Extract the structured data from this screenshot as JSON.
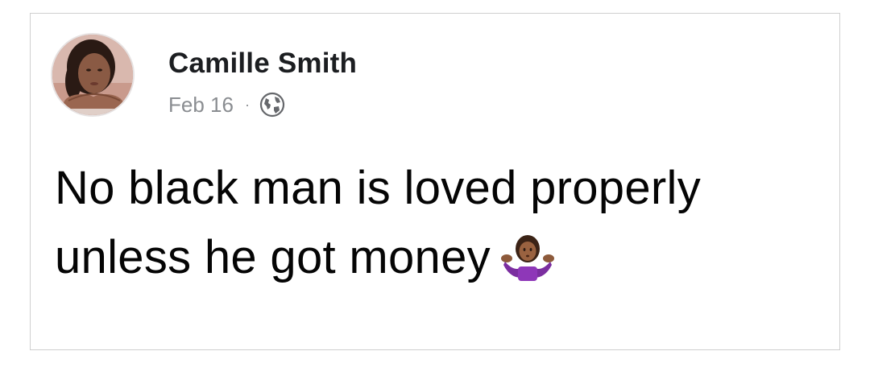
{
  "post": {
    "author_name": "Camille Smith",
    "date": "Feb 16",
    "separator": "·",
    "privacy_icon": "globe-icon",
    "text_line_1": "No black man is loved properly",
    "text_line_2": "unless he got money",
    "emoji": "person-shrugging-emoji"
  },
  "colors": {
    "name_text": "#1c1e21",
    "meta_text": "#8a8d91",
    "body_text": "#050505",
    "border": "#cfcfcf"
  }
}
